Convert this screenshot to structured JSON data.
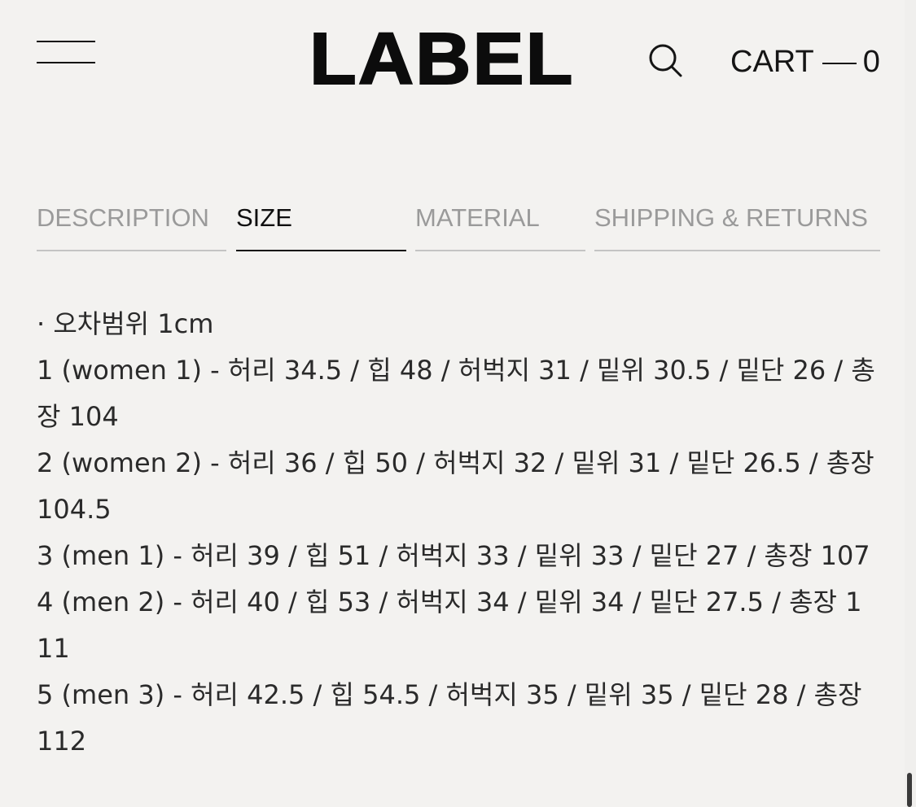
{
  "header": {
    "menu_icon": "hamburger-menu-icon",
    "logo_text": "LABEL",
    "search_icon": "search-icon",
    "cart_label": "CART",
    "cart_count": "0"
  },
  "tabs": [
    {
      "label": "DESCRIPTION",
      "active": false
    },
    {
      "label": "SIZE",
      "active": true
    },
    {
      "label": "MATERIAL",
      "active": false
    },
    {
      "label": "SHIPPING & RETURNS",
      "active": false
    }
  ],
  "size_info": {
    "tolerance": "· 오차범위 1cm",
    "rows": [
      "1 (women 1) - 허리 34.5 / 힙 48 / 허벅지 31 / 밑위 30.5 / 밑단 26 / 총장 104",
      "2 (women 2) - 허리 36 / 힙 50 / 허벅지 32 / 밑위 31 / 밑단 26.5 / 총장 104.5",
      "3 (men 1) - 허리 39 / 힙 51 / 허벅지 33 / 밑위 33 / 밑단 27 / 총장 107",
      "4 (men 2) - 허리 40 / 힙 53 / 허벅지 34 / 밑위 34 / 밑단 27.5 / 총장 111",
      "5 (men 3) - 허리 42.5 / 힙 54.5 / 허벅지 35 / 밑위 35 / 밑단 28 / 총장 112"
    ]
  },
  "colors": {
    "background": "#f3f2f0",
    "text": "#1a1a1a",
    "inactive_tab": "#9a9a9a",
    "inactive_underline": "#c4c4c4",
    "active": "#0f0f0f"
  }
}
